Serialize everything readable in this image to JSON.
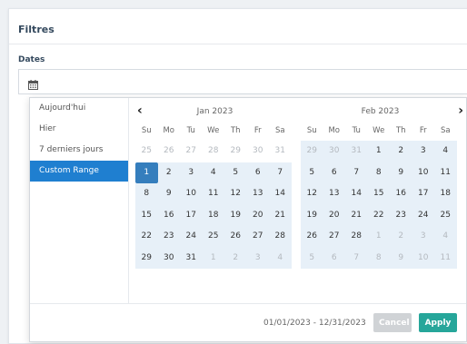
{
  "panel": {
    "title": "Filtres"
  },
  "dates": {
    "label": "Dates",
    "value": ""
  },
  "ranges": [
    {
      "label": "Aujourd'hui",
      "active": false
    },
    {
      "label": "Hier",
      "active": false
    },
    {
      "label": "7 derniers jours",
      "active": false
    },
    {
      "label": "Custom Range",
      "active": true
    }
  ],
  "calendar": {
    "weekdays": [
      "Su",
      "Mo",
      "Tu",
      "We",
      "Th",
      "Fr",
      "Sa"
    ],
    "months": [
      {
        "title": "Jan 2023",
        "weeks": [
          [
            "25",
            "26",
            "27",
            "28",
            "29",
            "30",
            "31"
          ],
          [
            "1",
            "2",
            "3",
            "4",
            "5",
            "6",
            "7"
          ],
          [
            "8",
            "9",
            "10",
            "11",
            "12",
            "13",
            "14"
          ],
          [
            "15",
            "16",
            "17",
            "18",
            "19",
            "20",
            "21"
          ],
          [
            "22",
            "23",
            "24",
            "25",
            "26",
            "27",
            "28"
          ],
          [
            "29",
            "30",
            "31",
            "1",
            "2",
            "3",
            "4"
          ]
        ],
        "first_in_month_index": 7,
        "last_in_month_index": 37
      },
      {
        "title": "Feb 2023",
        "weeks": [
          [
            "29",
            "30",
            "31",
            "1",
            "2",
            "3",
            "4"
          ],
          [
            "5",
            "6",
            "7",
            "8",
            "9",
            "10",
            "11"
          ],
          [
            "12",
            "13",
            "14",
            "15",
            "16",
            "17",
            "18"
          ],
          [
            "19",
            "20",
            "21",
            "22",
            "23",
            "24",
            "25"
          ],
          [
            "26",
            "27",
            "28",
            "1",
            "2",
            "3",
            "4"
          ],
          [
            "5",
            "6",
            "7",
            "8",
            "9",
            "10",
            "11"
          ]
        ],
        "first_in_month_index": 3,
        "last_in_month_index": 30
      }
    ],
    "selected_start": "2023-01-01",
    "selected_end": "2023-12-31"
  },
  "footer": {
    "range_text": "01/01/2023 - 12/31/2023",
    "cancel_label": "Cancel",
    "apply_label": "Apply"
  },
  "colors": {
    "accent": "#357ebd",
    "range_highlight": "#e7f0f8",
    "apply": "#26a69a",
    "cancel": "#d0d3d6"
  }
}
